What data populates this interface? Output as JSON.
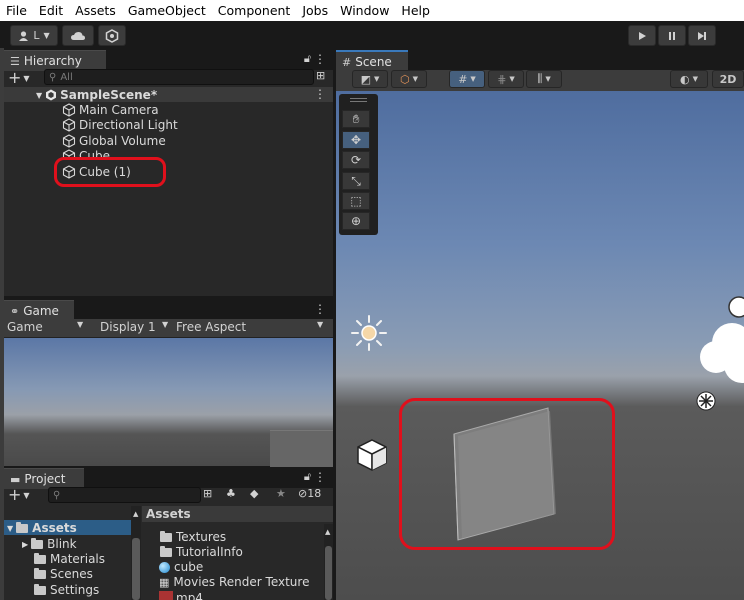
{
  "menu": [
    "File",
    "Edit",
    "Assets",
    "GameObject",
    "Component",
    "Jobs",
    "Window",
    "Help"
  ],
  "toolbar": {
    "account_label": "L"
  },
  "hierarchy": {
    "tab": "Hierarchy",
    "search_placeholder": "All",
    "scene_name": "SampleScene*",
    "items": [
      "Main Camera",
      "Directional Light",
      "Global Volume",
      "Cube",
      "Cube (1)"
    ]
  },
  "scene": {
    "tab": "Scene",
    "mode_2d": "2D"
  },
  "game": {
    "tab": "Game",
    "dropdown_game": "Game",
    "display": "Display 1",
    "aspect": "Free Aspect"
  },
  "project": {
    "tab": "Project",
    "hidden_count": "18",
    "tree_root": "Assets",
    "tree": [
      "Blink",
      "Materials",
      "Scenes",
      "Settings"
    ],
    "breadcrumb": "Assets",
    "assets": [
      "Textures",
      "TutorialInfo",
      "cube",
      "Movies Render Texture",
      "mp4"
    ]
  },
  "colors": {
    "highlight_red": "#e0101c",
    "panel_bg": "#282828",
    "sky_top": "#5f7db0"
  },
  "icons": [
    "cloud-icon",
    "play-icon",
    "pause-icon",
    "step-icon",
    "hand-tool-icon",
    "move-tool-icon",
    "rotate-tool-icon",
    "scale-tool-icon",
    "rect-tool-icon",
    "transform-tool-icon",
    "sun-icon",
    "cube-gizmo-icon",
    "camera-gizmo-icon",
    "lock-icon",
    "kebab-icon"
  ]
}
